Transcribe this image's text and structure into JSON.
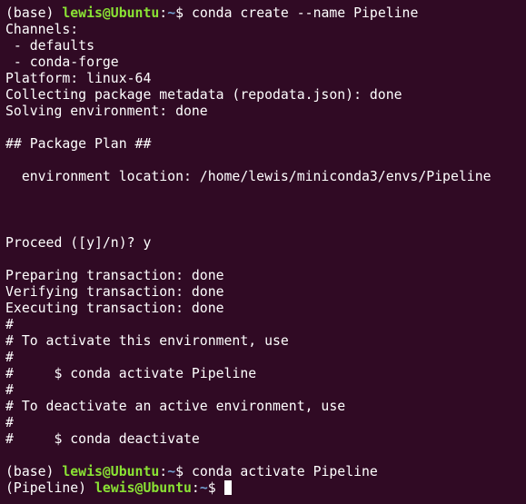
{
  "colors": {
    "background": "#300a24",
    "text": "#ffffff",
    "user_host": "#8ae234",
    "path": "#729fcf"
  },
  "prompt1": {
    "env": "(base) ",
    "user_host": "lewis@Ubuntu",
    "colon": ":",
    "path": "~",
    "symbol": "$ ",
    "command": "conda create --name Pipeline"
  },
  "output": [
    "Channels:",
    " - defaults",
    " - conda-forge",
    "Platform: linux-64",
    "Collecting package metadata (repodata.json): done",
    "Solving environment: done",
    "",
    "## Package Plan ##",
    "",
    "  environment location: /home/lewis/miniconda3/envs/Pipeline",
    "",
    "",
    "",
    "Proceed ([y]/n)? y",
    "",
    "Preparing transaction: done",
    "Verifying transaction: done",
    "Executing transaction: done",
    "#",
    "# To activate this environment, use",
    "#",
    "#     $ conda activate Pipeline",
    "#",
    "# To deactivate an active environment, use",
    "#",
    "#     $ conda deactivate",
    ""
  ],
  "prompt2": {
    "env": "(base) ",
    "user_host": "lewis@Ubuntu",
    "colon": ":",
    "path": "~",
    "symbol": "$ ",
    "command": "conda activate Pipeline"
  },
  "prompt3": {
    "env": "(Pipeline) ",
    "user_host": "lewis@Ubuntu",
    "colon": ":",
    "path": "~",
    "symbol": "$ ",
    "command": ""
  }
}
